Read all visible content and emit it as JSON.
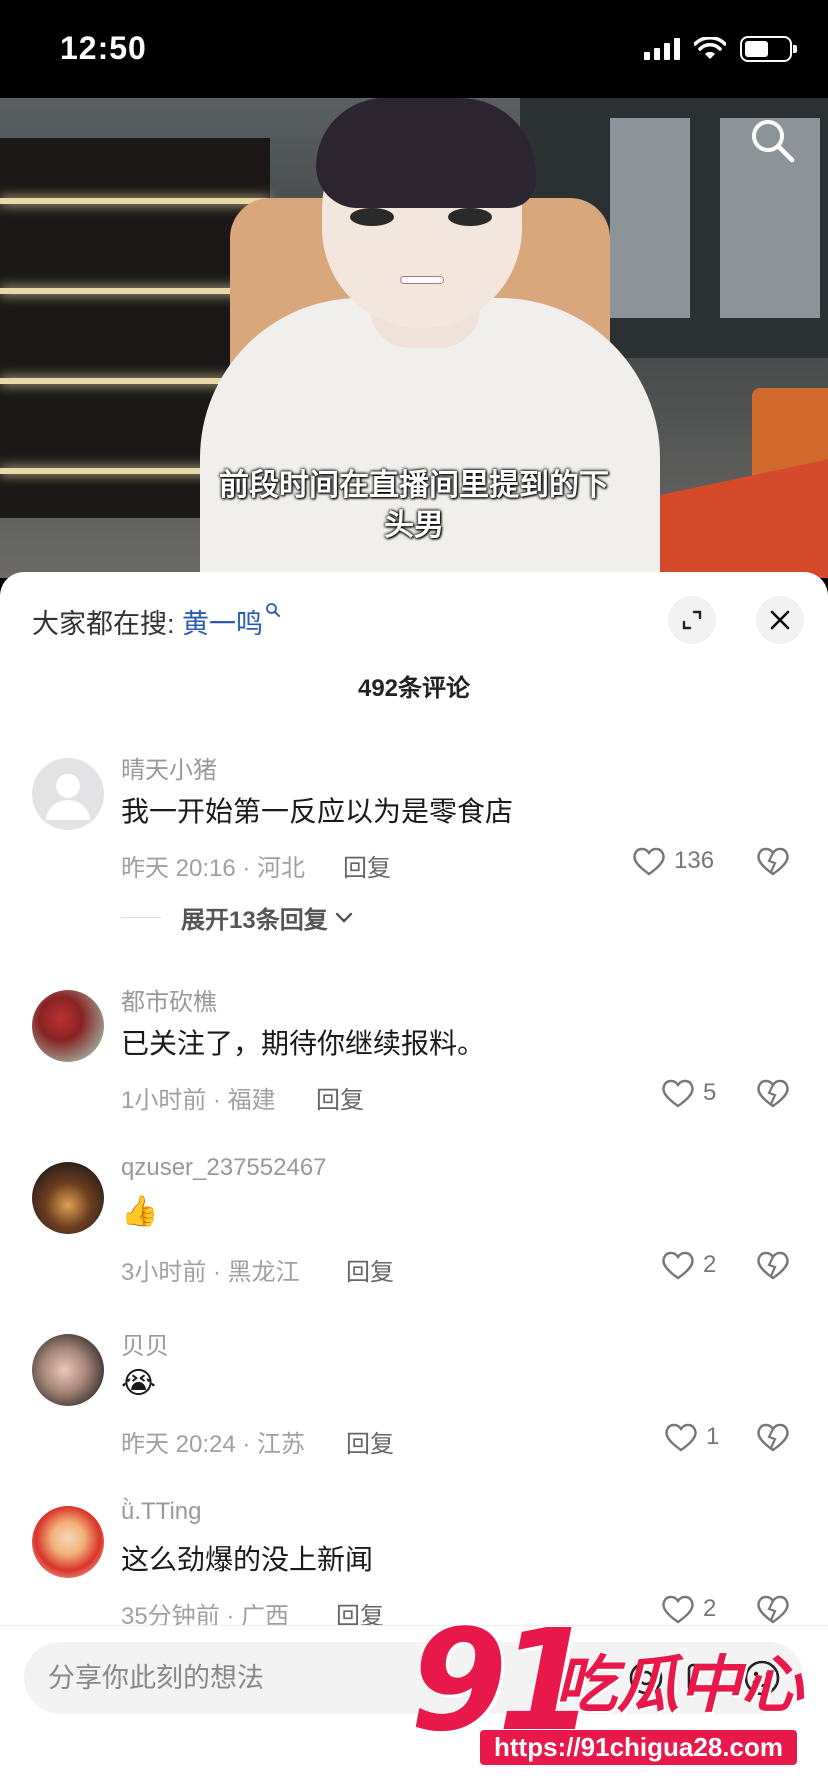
{
  "status": {
    "time": "12:50"
  },
  "video": {
    "subtitle_line1": "前段时间在直播间里提到的下",
    "subtitle_line2": "头男"
  },
  "sheet": {
    "search_prefix": "大家都在搜: ",
    "search_keyword": "黄一鸣",
    "comment_count": "492条评论"
  },
  "comments": [
    {
      "user": "晴天小猪",
      "text": "我一开始第一反应以为是零食店",
      "meta": "昨天 20:16 · 河北",
      "reply": "回复",
      "likes": "136",
      "expand": "展开13条回复"
    },
    {
      "user": "都市砍樵",
      "text": "已关注了，期待你继续报料。",
      "meta": "1小时前 · 福建",
      "reply": "回复",
      "likes": "5"
    },
    {
      "user": "qzuser_237552467",
      "text": "👍",
      "meta": "3小时前 · 黑龙江",
      "reply": "回复",
      "likes": "2"
    },
    {
      "user": "贝贝",
      "text": "😭",
      "meta": "昨天 20:24 · 江苏",
      "reply": "回复",
      "likes": "1"
    },
    {
      "user": "ǜ.TTing",
      "text": "这么劲爆的没上新闻",
      "meta": "35分钟前 · 广西",
      "reply": "回复",
      "likes": "2"
    }
  ],
  "input": {
    "placeholder": "分享你此刻的想法"
  },
  "watermark": {
    "logo": "91",
    "brand": "吃瓜中心",
    "url": "https://91chigua28.com"
  },
  "colors": {
    "link": "#2a5bb5",
    "watermark": "#e8194a"
  },
  "icons": [
    "search-icon",
    "expand-icon",
    "close-icon",
    "heart-icon",
    "broken-heart-icon",
    "emoji-icon",
    "at-icon",
    "image-icon"
  ]
}
